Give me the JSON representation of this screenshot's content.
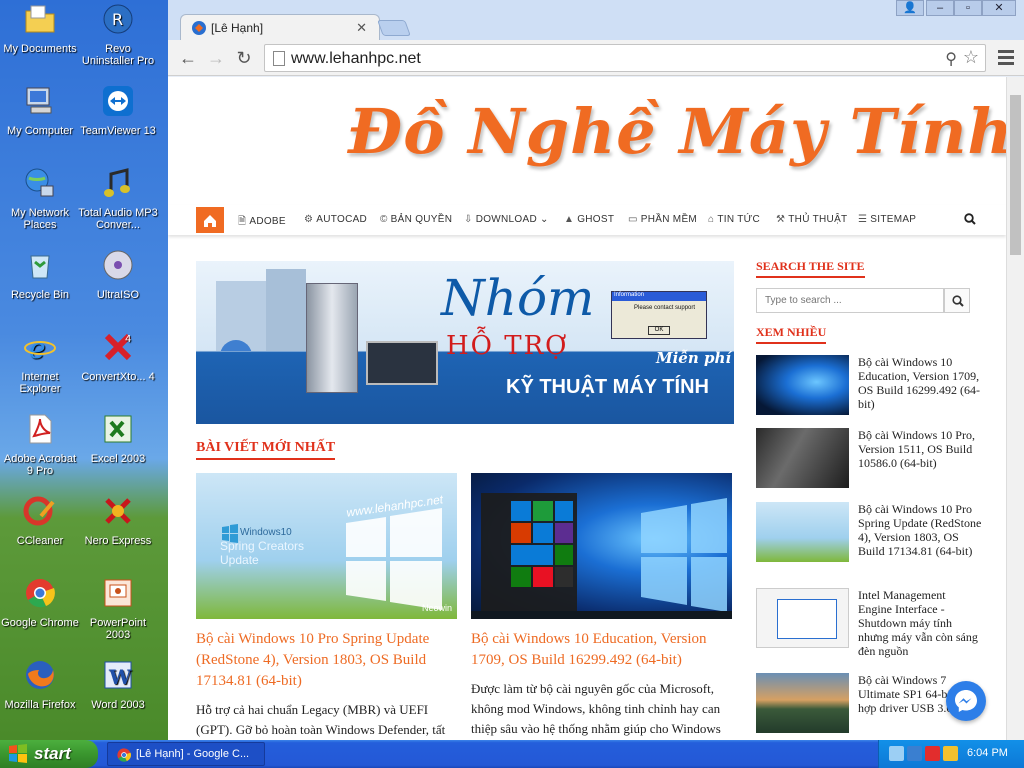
{
  "desktop": {
    "icons": [
      {
        "label": "My Documents"
      },
      {
        "label": "Revo Uninstaller Pro"
      },
      {
        "label": "My Computer"
      },
      {
        "label": "TeamViewer 13"
      },
      {
        "label": "My Network Places"
      },
      {
        "label": "Total Audio MP3 Conver..."
      },
      {
        "label": "Recycle Bin"
      },
      {
        "label": "UltraISO"
      },
      {
        "label": "Internet Explorer"
      },
      {
        "label": "ConvertXto... 4"
      },
      {
        "label": "Adobe Acrobat 9 Pro"
      },
      {
        "label": "Excel 2003"
      },
      {
        "label": "CCleaner"
      },
      {
        "label": "Nero Express"
      },
      {
        "label": "Google Chrome"
      },
      {
        "label": "PowerPoint 2003"
      },
      {
        "label": "Mozilla Firefox"
      },
      {
        "label": "Word 2003"
      }
    ]
  },
  "browser": {
    "tab_title": "[Lê Hạnh]",
    "url": "www.lehanhpc.net"
  },
  "site": {
    "logo_text": "Đồ Nghề Máy Tính",
    "nav": [
      {
        "label": "ADOBE"
      },
      {
        "label": "AUTOCAD"
      },
      {
        "label": "BẢN QUYỀN"
      },
      {
        "label": "DOWNLOAD ⌄"
      },
      {
        "label": "GHOST"
      },
      {
        "label": "PHẦN MỀM"
      },
      {
        "label": "TIN TỨC"
      },
      {
        "label": "THỦ THUẬT"
      },
      {
        "label": "SITEMAP"
      }
    ],
    "banner": {
      "title": "Nhóm",
      "subtitle": "HỖ TRỢ",
      "tagline": "KỸ THUẬT MÁY TÍNH",
      "free": "Miễn phí",
      "dialog_title": "Information",
      "dialog_text": "Please contact support",
      "dialog_ok": "OK"
    },
    "latest_heading": "BÀI VIẾT MỚI NHẤT",
    "posts": [
      {
        "title": "Bộ cài Windows 10 Pro Spring Update (RedStone 4), Version 1803, OS Build 17134.81 (64-bit)",
        "excerpt": "Hỗ trợ cả hai chuẩn Legacy (MBR) và UEFI (GPT).  Gỡ bỏ hoàn toàn Windows Defender, tất",
        "thumb_url_text": "www.lehanhpc.net",
        "thumb_line1": "Windows10",
        "thumb_line2": "Spring Creators",
        "thumb_line3": "Update",
        "thumb_credit": "Neowin"
      },
      {
        "title": "Bộ cài Windows 10 Education, Version 1709, OS Build 16299.492 (64-bit)",
        "excerpt": "Được làm từ bộ cài nguyên gốc của Microsoft, không mod Windows, không tinh chỉnh hay can thiệp sâu vào hệ thống nhằm giúp cho Windows"
      }
    ],
    "sidebar": {
      "search_heading": "SEARCH THE SITE",
      "search_placeholder": "Type to search ...",
      "popular_heading": "XEM NHIỀU",
      "items": [
        {
          "title": "Bộ cài Windows 10 Education, Version 1709, OS Build 16299.492 (64-bit)"
        },
        {
          "title": "Bộ cài Windows 10 Pro, Version 1511, OS Build 10586.0 (64-bit)"
        },
        {
          "title": "Bộ cài Windows 10 Pro Spring Update (RedStone 4), Version 1803, OS Build 17134.81 (64-bit)"
        },
        {
          "title": "Intel Management Engine Interface - Shutdown máy tính nhưng máy vẫn còn sáng đèn nguồn"
        },
        {
          "title": "Bộ cài Windows 7 Ultimate SP1 64-bit Tích hợp driver USB 3.0"
        }
      ]
    }
  },
  "taskbar": {
    "start_label": "start",
    "task_label": "[Lê Hạnh] - Google C...",
    "clock": "6:04 PM"
  },
  "colors": {
    "accent": "#f06b22",
    "heading_red": "#e0311b",
    "post_title": "#ee6b24"
  }
}
